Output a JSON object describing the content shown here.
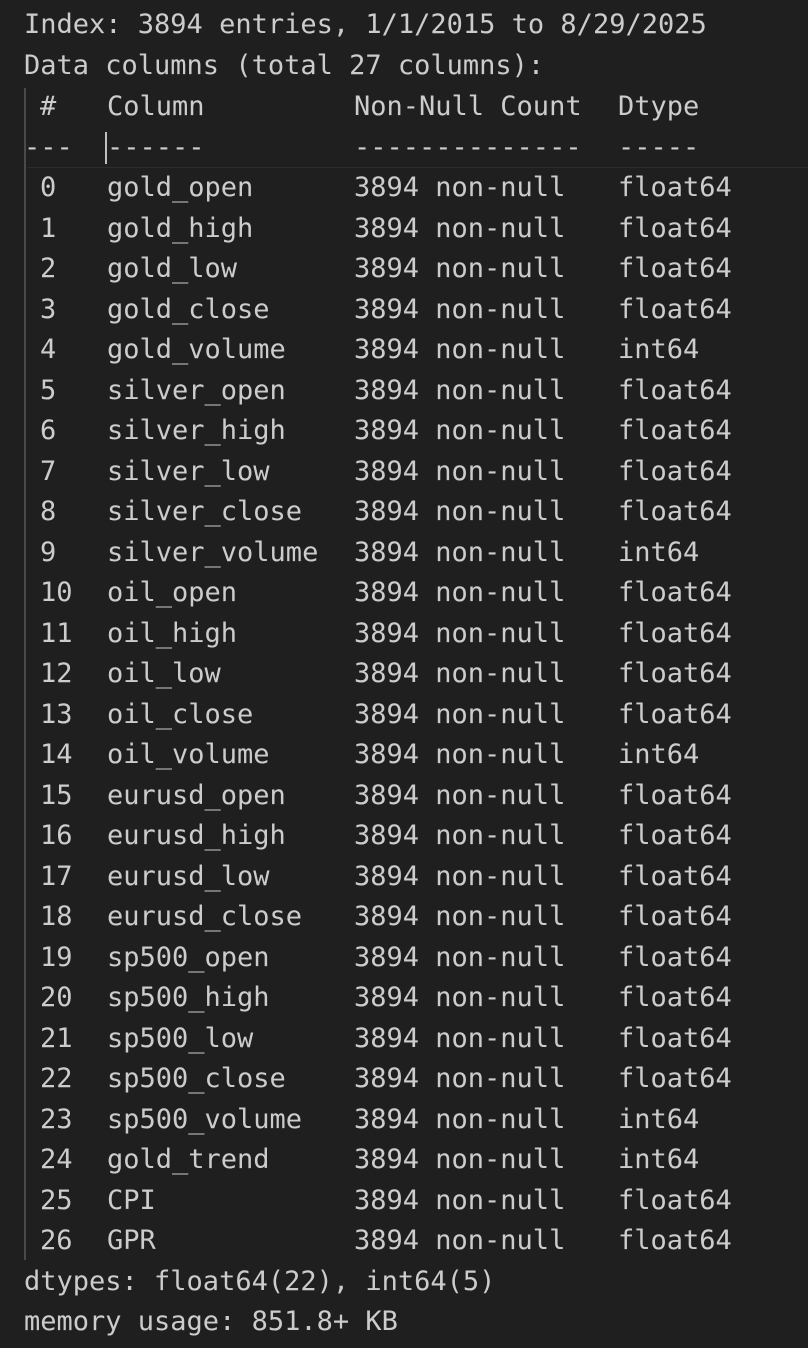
{
  "header": {
    "partial_top": "",
    "index_line": "Index: 3894 entries, 1/1/2015 to 8/29/2025",
    "data_columns_line": "Data columns (total 27 columns):"
  },
  "table": {
    "headers": {
      "index": "#",
      "column": "Column",
      "non_null": "Non-Null Count",
      "dtype": "Dtype"
    },
    "separators": {
      "index": "---",
      "column": "------",
      "non_null": "--------------",
      "dtype": "-----"
    },
    "rows": [
      {
        "idx": "0",
        "column": "gold_open",
        "non_null": "3894 non-null",
        "dtype": "float64"
      },
      {
        "idx": "1",
        "column": "gold_high",
        "non_null": "3894 non-null",
        "dtype": "float64"
      },
      {
        "idx": "2",
        "column": "gold_low",
        "non_null": "3894 non-null",
        "dtype": "float64"
      },
      {
        "idx": "3",
        "column": "gold_close",
        "non_null": "3894 non-null",
        "dtype": "float64"
      },
      {
        "idx": "4",
        "column": "gold_volume",
        "non_null": "3894 non-null",
        "dtype": "int64"
      },
      {
        "idx": "5",
        "column": "silver_open",
        "non_null": "3894 non-null",
        "dtype": "float64"
      },
      {
        "idx": "6",
        "column": "silver_high",
        "non_null": "3894 non-null",
        "dtype": "float64"
      },
      {
        "idx": "7",
        "column": "silver_low",
        "non_null": "3894 non-null",
        "dtype": "float64"
      },
      {
        "idx": "8",
        "column": "silver_close",
        "non_null": "3894 non-null",
        "dtype": "float64"
      },
      {
        "idx": "9",
        "column": "silver_volume",
        "non_null": "3894 non-null",
        "dtype": "int64"
      },
      {
        "idx": "10",
        "column": "oil_open",
        "non_null": "3894 non-null",
        "dtype": "float64"
      },
      {
        "idx": "11",
        "column": "oil_high",
        "non_null": "3894 non-null",
        "dtype": "float64"
      },
      {
        "idx": "12",
        "column": "oil_low",
        "non_null": "3894 non-null",
        "dtype": "float64"
      },
      {
        "idx": "13",
        "column": "oil_close",
        "non_null": "3894 non-null",
        "dtype": "float64"
      },
      {
        "idx": "14",
        "column": "oil_volume",
        "non_null": "3894 non-null",
        "dtype": "int64"
      },
      {
        "idx": "15",
        "column": "eurusd_open",
        "non_null": "3894 non-null",
        "dtype": "float64"
      },
      {
        "idx": "16",
        "column": "eurusd_high",
        "non_null": "3894 non-null",
        "dtype": "float64"
      },
      {
        "idx": "17",
        "column": "eurusd_low",
        "non_null": "3894 non-null",
        "dtype": "float64"
      },
      {
        "idx": "18",
        "column": "eurusd_close",
        "non_null": "3894 non-null",
        "dtype": "float64"
      },
      {
        "idx": "19",
        "column": "sp500_open",
        "non_null": "3894 non-null",
        "dtype": "float64"
      },
      {
        "idx": "20",
        "column": "sp500_high",
        "non_null": "3894 non-null",
        "dtype": "float64"
      },
      {
        "idx": "21",
        "column": "sp500_low",
        "non_null": "3894 non-null",
        "dtype": "float64"
      },
      {
        "idx": "22",
        "column": "sp500_close",
        "non_null": "3894 non-null",
        "dtype": "float64"
      },
      {
        "idx": "23",
        "column": "sp500_volume",
        "non_null": "3894 non-null",
        "dtype": "int64"
      },
      {
        "idx": "24",
        "column": "gold_trend",
        "non_null": "3894 non-null",
        "dtype": "int64"
      },
      {
        "idx": "25",
        "column": "CPI",
        "non_null": "3894 non-null",
        "dtype": "float64"
      },
      {
        "idx": "26",
        "column": "GPR",
        "non_null": "3894 non-null",
        "dtype": "float64"
      }
    ]
  },
  "footer": {
    "dtypes_line": "dtypes: float64(22), int64(5)",
    "memory_line": "memory usage: 851.8+ KB"
  },
  "colors": {
    "background": "#1f1f1f",
    "text": "#cccccc"
  }
}
